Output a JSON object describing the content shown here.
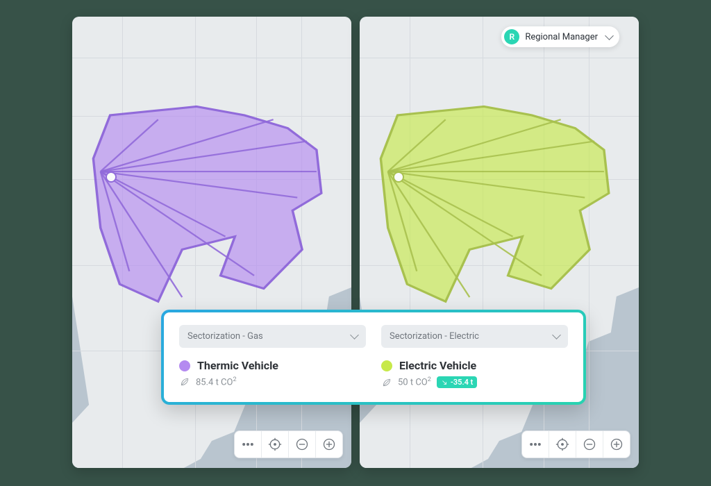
{
  "role_selector": {
    "avatar_initial": "R",
    "label": "Regional Manager"
  },
  "panels": {
    "left": {
      "overlay_color": "#b48af0",
      "overlay_stroke": "#7e4fd6"
    },
    "right": {
      "overlay_color": "#c7e94a",
      "overlay_stroke": "#9bb82d"
    }
  },
  "legend": {
    "left": {
      "select_label": "Sectorization - Gas",
      "vehicle_label": "Thermic Vehicle",
      "co2_value": "85.4 t CO",
      "co2_sup": "2"
    },
    "right": {
      "select_label": "Sectorization - Electric",
      "vehicle_label": "Electric Vehicle",
      "co2_value": "50 t CO",
      "co2_sup": "2",
      "delta": "-35.4 t"
    }
  },
  "icons": {
    "more": "more-icon",
    "center": "crosshair-icon",
    "zoom_out": "minus-icon",
    "zoom_in": "plus-icon",
    "leaf": "leaf-icon",
    "arrow_dr": "arrow-down-right-icon"
  }
}
